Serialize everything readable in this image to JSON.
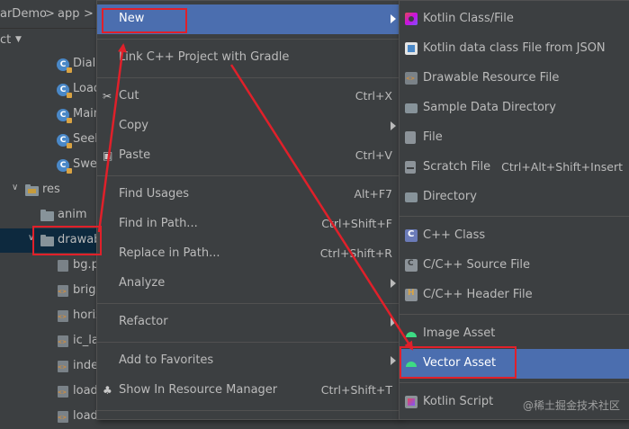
{
  "breadcrumb": {
    "project": "arDemo",
    "separator": ">",
    "module": "app",
    "separator2": ">"
  },
  "panel": {
    "title": "ct",
    "dropdown": "▼"
  },
  "tree": [
    {
      "label": "Dialo",
      "icon": "kotlin-class-icon",
      "letter": "C"
    },
    {
      "label": "Load",
      "icon": "kotlin-class-icon",
      "letter": "C"
    },
    {
      "label": "Main",
      "icon": "kotlin-class-icon",
      "letter": "C"
    },
    {
      "label": "Seek",
      "icon": "kotlin-class-icon",
      "letter": "C"
    },
    {
      "label": "Swee",
      "icon": "kotlin-class-icon",
      "letter": "C"
    },
    {
      "label": "res",
      "icon": "res-folder-icon",
      "arrow": "∨"
    },
    {
      "label": "anim",
      "icon": "folder-icon"
    },
    {
      "label": "drawab",
      "icon": "folder-icon",
      "arrow": "∨",
      "selected": true
    },
    {
      "label": "bg.p",
      "icon": "image-file-icon"
    },
    {
      "label": "brig",
      "icon": "xml-file-icon"
    },
    {
      "label": "horiz",
      "icon": "xml-file-icon"
    },
    {
      "label": "ic_la",
      "icon": "xml-file-icon"
    },
    {
      "label": "inde",
      "icon": "xml-file-icon"
    },
    {
      "label": "load",
      "icon": "xml-file-icon"
    },
    {
      "label": "load",
      "icon": "xml-file-icon"
    }
  ],
  "context_menu": {
    "items": [
      {
        "label": "New",
        "shortcut": "",
        "submenu": true,
        "highlighted": true
      },
      {
        "label": "Link C++ Project with Gradle",
        "shortcut": "",
        "submenu": false
      },
      {
        "label": "Cut",
        "shortcut": "Ctrl+X",
        "icon": "scissors-icon"
      },
      {
        "label": "Copy",
        "shortcut": "",
        "submenu": true
      },
      {
        "label": "Paste",
        "shortcut": "Ctrl+V",
        "icon": "clipboard-icon"
      },
      {
        "label": "Find Usages",
        "shortcut": "Alt+F7"
      },
      {
        "label": "Find in Path...",
        "shortcut": "Ctrl+Shift+F"
      },
      {
        "label": "Replace in Path...",
        "shortcut": "Ctrl+Shift+R"
      },
      {
        "label": "Analyze",
        "shortcut": "",
        "submenu": true
      },
      {
        "label": "Refactor",
        "shortcut": "",
        "submenu": true
      },
      {
        "label": "Add to Favorites",
        "shortcut": "",
        "submenu": true
      },
      {
        "label": "Show In Resource Manager",
        "shortcut": "Ctrl+Shift+T",
        "icon": "resource-manager-icon"
      },
      {
        "label": "",
        "shortcut": ""
      }
    ]
  },
  "submenu": {
    "items": [
      {
        "label": "Kotlin Class/File",
        "shortcut": ""
      },
      {
        "label": "Kotlin data class File from JSON",
        "shortcut": ""
      },
      {
        "label": "Drawable Resource File",
        "shortcut": ""
      },
      {
        "label": "Sample Data Directory",
        "shortcut": ""
      },
      {
        "label": "File",
        "shortcut": ""
      },
      {
        "label": "Scratch File",
        "shortcut": "Ctrl+Alt+Shift+Insert"
      },
      {
        "label": "Directory",
        "shortcut": ""
      },
      {
        "label": "C++ Class",
        "shortcut": ""
      },
      {
        "label": "C/C++ Source File",
        "shortcut": ""
      },
      {
        "label": "C/C++ Header File",
        "shortcut": ""
      },
      {
        "label": "Image Asset",
        "shortcut": ""
      },
      {
        "label": "Vector Asset",
        "shortcut": "",
        "highlighted": true
      },
      {
        "label": "Kotlin Script",
        "shortcut": ""
      }
    ]
  },
  "watermark": "@稀土掘金技术社区",
  "colors": {
    "highlight": "#4b6eaf",
    "annotation": "#e0202a",
    "background": "#3c3f41"
  }
}
